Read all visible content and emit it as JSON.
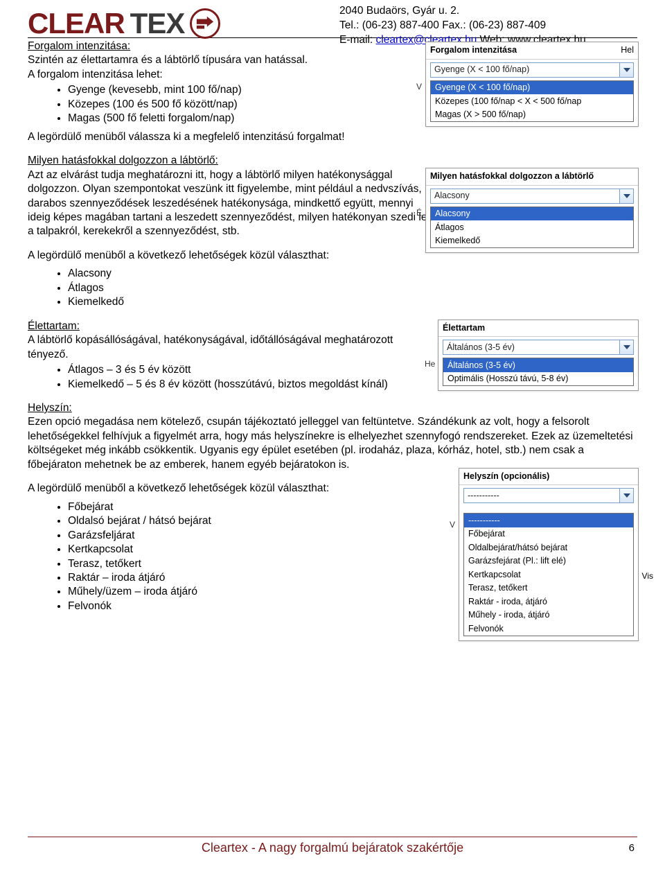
{
  "header": {
    "logo_clear": "CLEAR",
    "logo_tex": "TEX",
    "contact_line1": "2040 Budaörs, Gyár u. 2.",
    "contact_tel": "Tel.: (06-23) 887-400  Fax.: (06-23) 887-409",
    "contact_email_label": "E-mail: ",
    "contact_email": "cleartex@cleartex.hu",
    "contact_web": " Web: www.cleartex.hu"
  },
  "forgalom": {
    "title": "Forgalom intenzitása:",
    "intro": "Szintén az élettartamra és a lábtörlő típusára van hatással.",
    "lead": "A forgalom intenzitása lehet:",
    "bullets": [
      "Gyenge (kevesebb, mint 100 fő/nap)",
      "Közepes (100 és 500 fő között/nap)",
      "Magas (500 fő feletti forgalom/nap)"
    ],
    "instruction": "A legördülő menüből válassza ki a megfelelő intenzitású forgalmat!",
    "inset": {
      "head_left": "Forgalom intenzitása",
      "head_right": "Hel",
      "combo_value": "Gyenge (X < 100 fő/nap)",
      "sidechar": "V",
      "options": [
        "Gyenge (X < 100 fő/nap)",
        "Közepes (100 fő/nap < X < 500 fő/nap",
        "Magas (X > 500 fő/nap)"
      ],
      "selected_index": 0
    }
  },
  "hatasfok": {
    "title": "Milyen hatásfokkal dolgozzon a lábtörlő:",
    "para": "Azt az elvárást tudja meghatározni itt, hogy a lábtörlő milyen hatékonysággal dolgozzon. Olyan szempontokat veszünk itt figyelembe, mint például a nedvszívás, darabos szennyeződések leszedésének hatékonysága, mindkettő együtt, mennyi ideig képes magában tartani a leszedett szennyeződést, milyen hatékonyan szedi le a talpakról, kerekekről a szennyeződést, stb.",
    "lead2": "A legördülő menüből a következő lehetőségek közül választhat:",
    "bullets": [
      "Alacsony",
      "Átlagos",
      "Kiemelkedő"
    ],
    "inset": {
      "head": "Milyen hatásfokkal dolgozzon a lábtörlő",
      "combo_value": "Alacsony",
      "sidechar": "É",
      "options": [
        "Alacsony",
        "Átlagos",
        "Kiemelkedő"
      ],
      "selected_index": 0
    }
  },
  "elettartam": {
    "title": "Élettartam:",
    "para": "A lábtörlő kopásállóságával, hatékonyságával, időtállóságával meghatározott tényező.",
    "bullets": [
      "Átlagos – 3 és 5 év között",
      "Kiemelkedő – 5 és 8 év között (hosszútávú, biztos megoldást kínál)"
    ],
    "inset": {
      "head": "Élettartam",
      "combo_value": "Általános (3-5 év)",
      "sidechar": "He",
      "options": [
        "Általános (3-5 év)",
        "Optimális (Hosszú távú, 5-8 év)"
      ],
      "selected_index": 0
    }
  },
  "helyszin": {
    "title": "Helyszín:",
    "para": "Ezen opció megadása nem kötelező, csupán tájékoztató jelleggel van feltüntetve. Szándékunk az volt, hogy a felsorolt lehetőségekkel felhívjuk a figyelmét arra, hogy más helyszínekre is elhelyezhet szennyfogó rendszereket. Ezek az üzemeltetési költségeket még inkább csökkentik. Ugyanis egy épület esetében (pl. irodaház, plaza, kórház, hotel, stb.) nem csak a főbejáraton mehetnek be az emberek, hanem egyéb bejáratokon is.",
    "lead2": "A legördülő menüből a következő lehetőségek közül választhat:",
    "bullets": [
      "Főbejárat",
      "Oldalsó bejárat / hátsó bejárat",
      "Garázsfeljárat",
      "Kertkapcsolat",
      "Terasz, tetőkert",
      "Raktár – iroda átjáró",
      "Műhely/üzem – iroda átjáró",
      "Felvonók"
    ],
    "inset": {
      "head": "Helyszín (opcionális)",
      "combo_value": "-----------",
      "sidechar_top": "V",
      "side_right": "Vis",
      "options": [
        "-----------",
        "Főbejárat",
        "Oldalbejárat/hátsó bejárat",
        "Garázsfejárat (Pl.: lift elé)",
        "Kertkapcsolat",
        "Terasz, tetőkert",
        "Raktár - iroda, átjáró",
        "Műhely - iroda, átjáró",
        "Felvonók"
      ],
      "selected_index": 0
    }
  },
  "footer": {
    "text": "Cleartex - A nagy forgalmú bejáratok szakértője",
    "page": "6"
  }
}
